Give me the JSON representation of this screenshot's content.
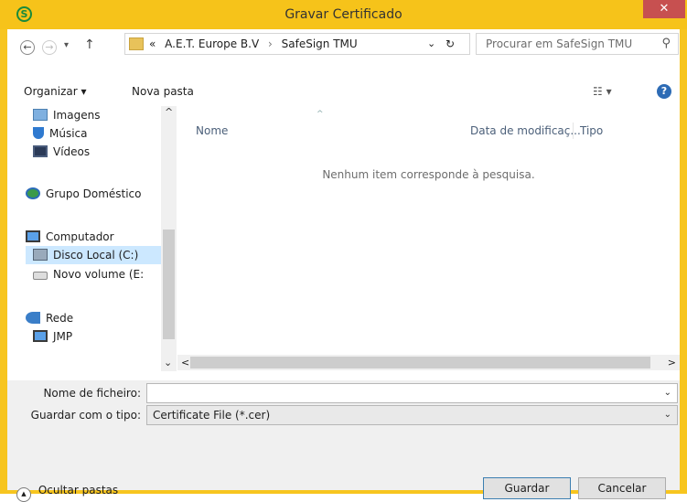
{
  "window": {
    "title": "Gravar Certificado",
    "app_icon_glyph": "S",
    "close_glyph": "✕",
    "accent": "#f6c31a",
    "close_color": "#c75050"
  },
  "address": {
    "path_prefix": "«",
    "crumbs": [
      "A.E.T. Europe B.V",
      "SafeSign TMU"
    ],
    "separator": "›",
    "dropdown_glyph": "⌄",
    "refresh_glyph": "↻"
  },
  "nav": {
    "back_glyph": "←",
    "forward_glyph": "→",
    "recent_glyph": "▾",
    "up_glyph": "↑"
  },
  "search": {
    "placeholder": "Procurar em SafeSign TMU",
    "icon_glyph": "⚲"
  },
  "toolbar": {
    "organize_label": "Organizar ▾",
    "new_folder_label": "Nova pasta",
    "view_glyph": "☷ ▾",
    "help_glyph": "?"
  },
  "sidebar": {
    "items": [
      {
        "label": "Imagens",
        "icon": "pictures-icon"
      },
      {
        "label": "Música",
        "icon": "music-icon"
      },
      {
        "label": "Vídeos",
        "icon": "videos-icon"
      },
      {
        "label": "Grupo Doméstico",
        "icon": "homegroup-icon"
      },
      {
        "label": "Computador",
        "icon": "computer-icon"
      },
      {
        "label": "Disco Local (C:)",
        "icon": "drive-icon",
        "selected": true
      },
      {
        "label": "Novo volume (E:",
        "icon": "drive-icon"
      },
      {
        "label": "Rede",
        "icon": "network-icon"
      },
      {
        "label": "JMP",
        "icon": "computer-icon"
      }
    ],
    "scroll_up_glyph": "^",
    "scroll_down_glyph": "⌄"
  },
  "content": {
    "columns": [
      "Nome",
      "Data de modificaç...",
      "Tipo"
    ],
    "sort_glyph": "^",
    "empty_message": "Nenhum item corresponde à pesquisa.",
    "hscroll_left": "<",
    "hscroll_right": ">"
  },
  "form": {
    "filename_label": "Nome de ficheiro:",
    "filename_value": "",
    "filetype_label": "Guardar com o tipo:",
    "filetype_value": "Certificate File (*.cer)",
    "chev_glyph": "⌄"
  },
  "footer": {
    "hide_folders_label": "Ocultar pastas",
    "hide_glyph": "▲",
    "save_label": "Guardar",
    "cancel_label": "Cancelar"
  }
}
